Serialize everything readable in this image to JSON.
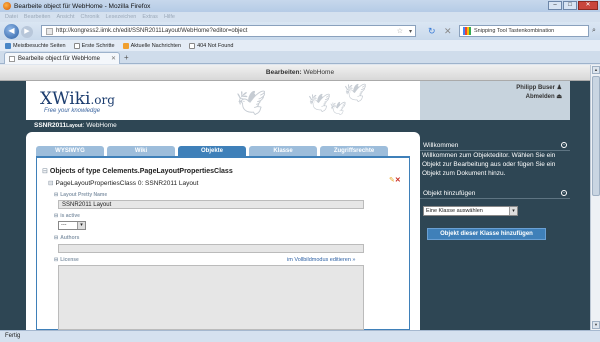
{
  "window": {
    "title": "Bearbeite object für WebHome - Mozilla Firefox",
    "controls": [
      "–",
      "□",
      "✕"
    ]
  },
  "menu": [
    "Datei",
    "Bearbeiten",
    "Ansicht",
    "Chronik",
    "Lesezeichen",
    "Extras",
    "Hilfe"
  ],
  "nav": {
    "url": "http://kongress2.iimk.ch/edit/SSNR2011Layout/WebHome?editor=object",
    "search_engine_text": "Snipping Tool Tastenkombination"
  },
  "bookmarks": [
    {
      "label": "Meistbesuchte Seiten",
      "icon": "bookmark-folder-icon"
    },
    {
      "label": "Erste Schritte",
      "icon": "page-icon"
    },
    {
      "label": "Aktuelle Nachrichten",
      "icon": "rss-icon"
    },
    {
      "label": "404 Not Found",
      "icon": "page-icon"
    }
  ],
  "tab": {
    "label": "Bearbeite object für WebHome",
    "new_tab": "+"
  },
  "page": {
    "edit_label": "Bearbeiten:",
    "edit_doc": "WebHome",
    "logo_text": "XWiki",
    "logo_suffix": ".org",
    "tagline": "Free your knowledge",
    "user_name": "Philipp Buser",
    "logout": "Abmelden",
    "title_space": "SSNR2011",
    "title_layout": "Layout",
    "title_sep": ": ",
    "title_doc": "WebHome"
  },
  "editor_tabs": [
    {
      "label": "WYSIWYG",
      "active": false
    },
    {
      "label": "Wiki",
      "active": false
    },
    {
      "label": "Objekte",
      "active": true
    },
    {
      "label": "Klasse",
      "active": false
    },
    {
      "label": "Zugriffsrechte",
      "active": false
    }
  ],
  "objects": {
    "heading": "Objects of type Celements.PageLayoutPropertiesClass",
    "sub": "PageLayoutPropertiesClass 0: SSNR2011 Layout",
    "fields": {
      "pretty_name_label": "Layout Pretty Name",
      "pretty_name_value": "SSNR2011 Layout",
      "is_active_label": "is active",
      "is_active_value": "---",
      "authors_label": "Authors",
      "license_label": "License",
      "fullscreen_link": "im Vollbildmodus editieren »"
    }
  },
  "sidebar": {
    "welcome_title": "Willkommen",
    "welcome_text": "Willkommen zum Objekteditor. Wählen Sie ein Objekt zur Bearbeitung aus oder fügen Sie ein Objekt zum Dokument hinzu.",
    "add_title": "Objekt hinzufügen",
    "class_select": "Eine Klasse auswählen",
    "add_button": "Objekt dieser Klasse hinzufügen"
  },
  "status": "Fertig",
  "colors": {
    "accent": "#3f80b9",
    "tab_inactive": "#9dbddb",
    "page_dark": "#2e4654"
  }
}
